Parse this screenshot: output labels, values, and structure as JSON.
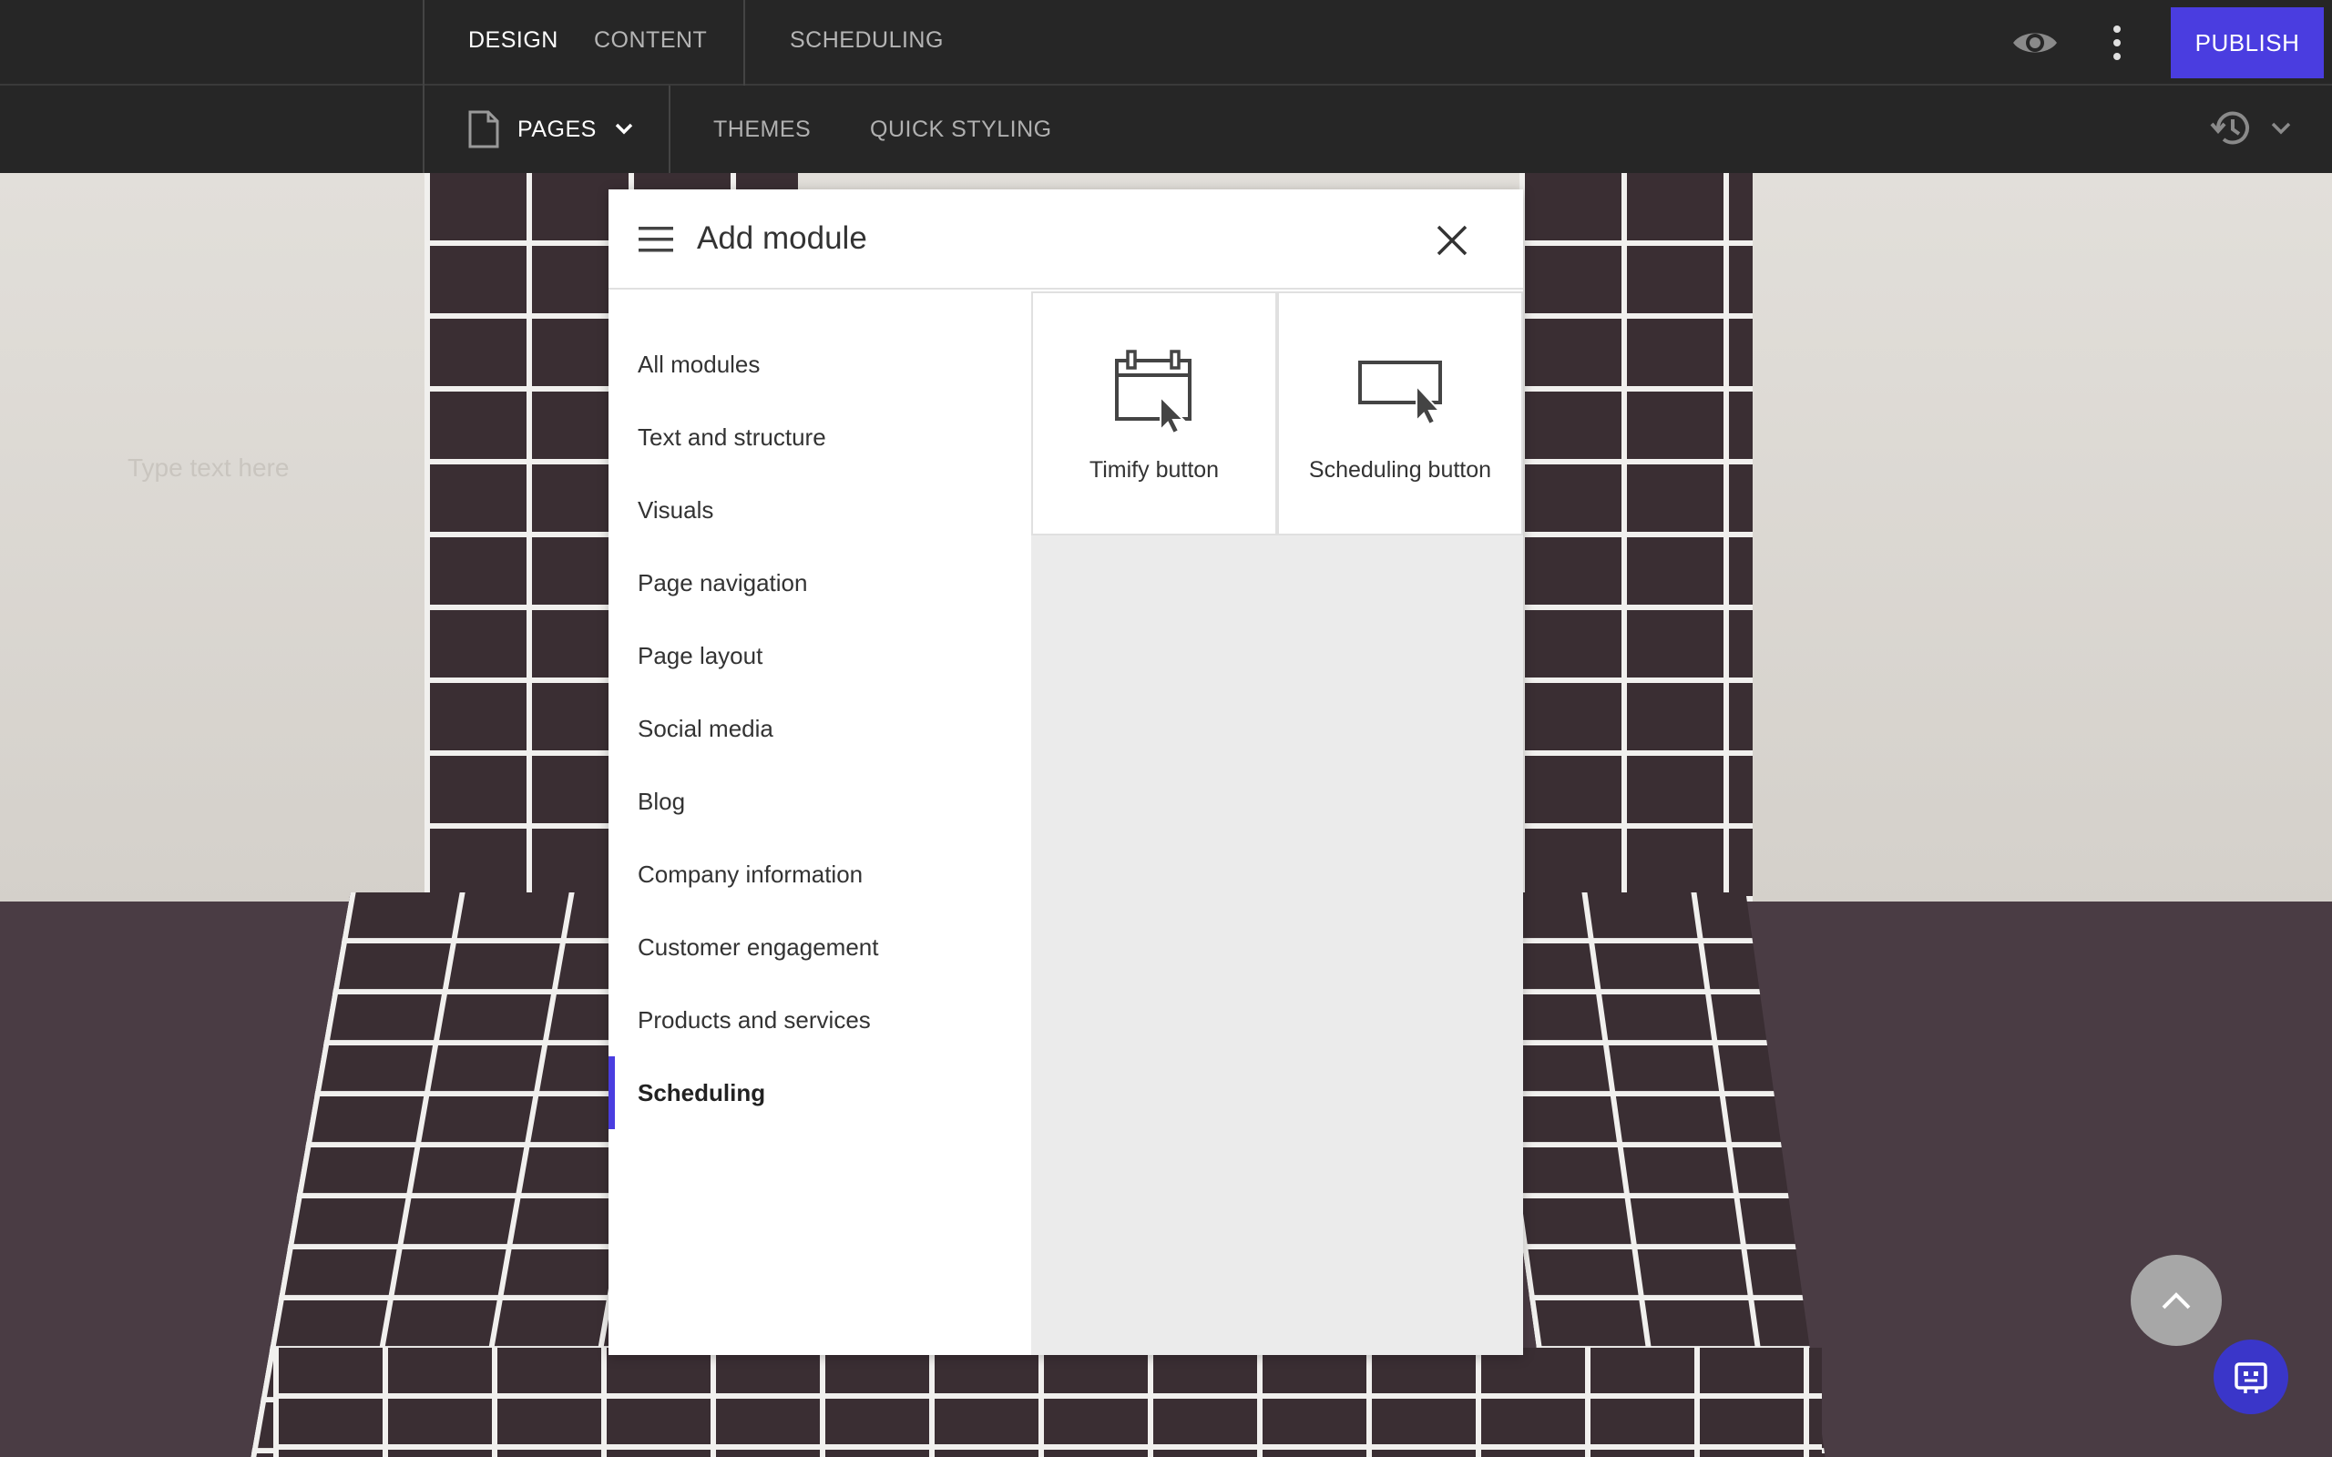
{
  "topbar": {
    "tabs": [
      {
        "label": "DESIGN",
        "active": true
      },
      {
        "label": "CONTENT",
        "active": false
      },
      {
        "label": "SCHEDULING",
        "active": false
      }
    ],
    "publish_label": "PUBLISH",
    "icons": [
      "eye-icon",
      "more-vertical-icon"
    ]
  },
  "subbar": {
    "pages_label": "PAGES",
    "tabs": [
      "THEMES",
      "QUICK STYLING"
    ],
    "icons": [
      "page-icon",
      "chevron-down-icon",
      "history-icon"
    ]
  },
  "canvas": {
    "placeholder": "Type text here"
  },
  "modal": {
    "title": "Add module",
    "categories": [
      "All modules",
      "Text and structure",
      "Visuals",
      "Page navigation",
      "Page layout",
      "Social media",
      "Blog",
      "Company information",
      "Customer engagement",
      "Products and services",
      "Scheduling"
    ],
    "active_category": "Scheduling",
    "modules": [
      {
        "label": "Timify button",
        "icon": "calendar-click-icon"
      },
      {
        "label": "Scheduling button",
        "icon": "button-click-icon"
      }
    ]
  },
  "colors": {
    "accent": "#4a3de0",
    "topbar_bg": "#262626",
    "chat_button": "#3a36c9"
  }
}
